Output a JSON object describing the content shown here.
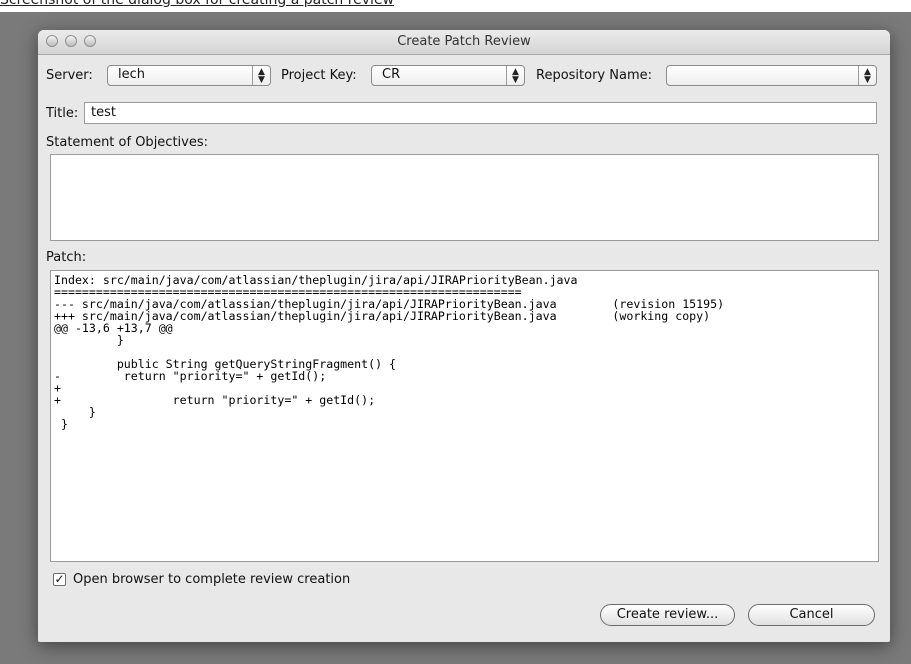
{
  "page_caption": "Screenshot of the dialog box for creating a patch review",
  "window": {
    "title": "Create Patch Review"
  },
  "form": {
    "server_label": "Server:",
    "server_value": "lech",
    "project_key_label": "Project Key:",
    "project_key_value": "CR",
    "repository_label": "Repository Name:",
    "repository_value": "",
    "title_label": "Title:",
    "title_value": "test",
    "objectives_label": "Statement of Objectives:",
    "objectives_value": "",
    "patch_label": "Patch:",
    "patch_text": "Index: src/main/java/com/atlassian/theplugin/jira/api/JIRAPriorityBean.java\n===================================================================\n--- src/main/java/com/atlassian/theplugin/jira/api/JIRAPriorityBean.java        (revision 15195)\n+++ src/main/java/com/atlassian/theplugin/jira/api/JIRAPriorityBean.java        (working copy)\n@@ -13,6 +13,7 @@\n         }\n\n         public String getQueryStringFragment() {\n-         return \"priority=\" + getId();\n+\n+                return \"priority=\" + getId();\n     }\n }",
    "open_browser_label": "Open browser to complete review creation",
    "open_browser_checked": true
  },
  "buttons": {
    "create": "Create review...",
    "cancel": "Cancel"
  }
}
